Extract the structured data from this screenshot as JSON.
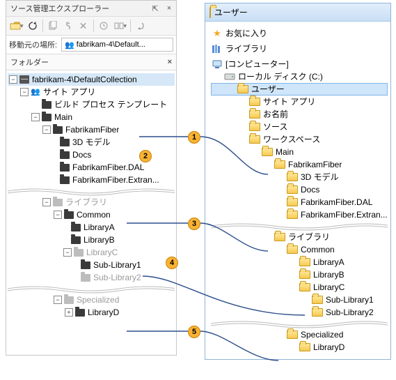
{
  "left": {
    "tab_title": "ソース管理エクスプローラー",
    "pin_glyph": "⇱",
    "close_glyph": "×",
    "location_label": "移動元の場所:",
    "location_value": "fabrikam-4\\Default...",
    "folder_header": "フォルダー",
    "folder_header_close": "×",
    "root": "fabrikam-4\\DefaultCollection",
    "site_app": "サイト アプリ",
    "build_tmpl": "ビルド プロセス テンプレート",
    "main": "Main",
    "ff": "FabrikamFiber",
    "ff_3d": "3D モデル",
    "ff_docs": "Docs",
    "ff_dal": "FabrikamFiber.DAL",
    "ff_ext": "FabrikamFiber.Extran...",
    "lib_root": "ライブラリ",
    "common": "Common",
    "libA": "LibraryA",
    "libB": "LibraryB",
    "libC": "LibraryC",
    "sub1": "Sub-Library1",
    "sub2": "Sub-Library2",
    "specialized": "Specialized",
    "libD": "LibraryD"
  },
  "right": {
    "win_title": "ユーザー",
    "fav": "お気に入り",
    "lib": "ライブラリ",
    "comp": "[コンピューター]",
    "disk": "ローカル ディスク (C:)",
    "users": "ユーザー",
    "site_app": "サイト アプリ",
    "oname": "お名前",
    "source": "ソース",
    "workspace": "ワークスペース",
    "main": "Main",
    "ff": "FabrikamFiber",
    "ff_3d": "3D モデル",
    "ff_docs": "Docs",
    "ff_dal": "FabrikamFiber.DAL",
    "ff_ext": "FabrikamFiber.Extran...",
    "lib_root": "ライブラリ",
    "common": "Common",
    "libA": "LibraryA",
    "libB": "LibraryB",
    "libC": "LibraryC",
    "sub1": "Sub-Library1",
    "sub2": "Sub-Library2",
    "specialized": "Specialized",
    "libD": "LibraryD"
  },
  "callouts": [
    "1",
    "2",
    "3",
    "4",
    "5"
  ]
}
